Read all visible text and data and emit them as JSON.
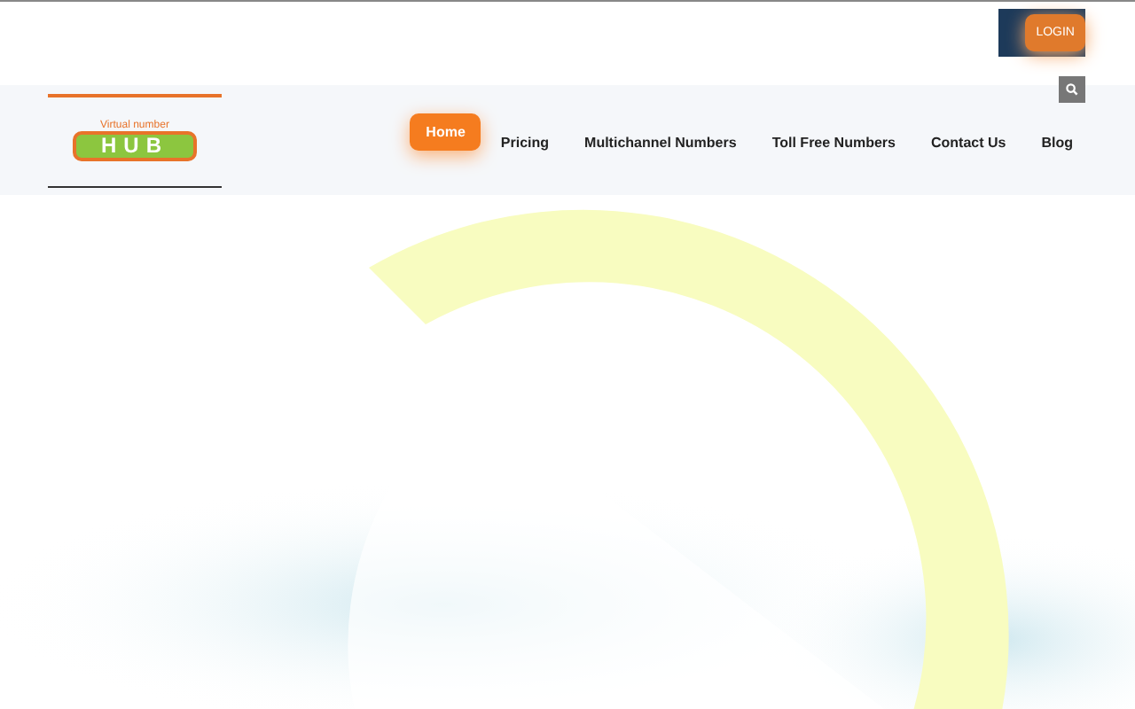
{
  "header": {
    "login_button": "LOGIN"
  },
  "logo": {
    "tagline": "Virtual number",
    "wordmark": "HUB"
  },
  "nav": [
    {
      "label": "Home",
      "selected": true
    },
    {
      "label": "Pricing",
      "selected": false
    },
    {
      "label": "Multichannel Numbers",
      "selected": false
    },
    {
      "label": "Toll Free Numbers",
      "selected": false
    },
    {
      "label": "Contact Us",
      "selected": false
    },
    {
      "label": "Blog",
      "selected": false
    }
  ]
}
